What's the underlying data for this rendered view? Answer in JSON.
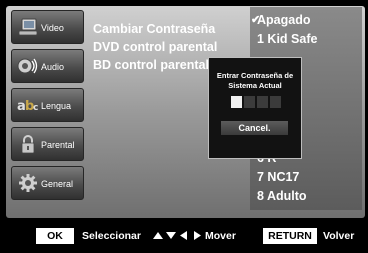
{
  "sidebar": {
    "items": [
      {
        "label": "Video",
        "icon": "video-icon"
      },
      {
        "label": "Audio",
        "icon": "speaker-icon"
      },
      {
        "label": "Lengua",
        "icon": "language-icon"
      },
      {
        "label": "Parental",
        "icon": "lock-icon"
      },
      {
        "label": "General",
        "icon": "gear-icon"
      }
    ]
  },
  "menu": {
    "items": [
      {
        "label": "Cambiar Contraseña"
      },
      {
        "label": "DVD control parental"
      },
      {
        "label": "BD control parental"
      }
    ]
  },
  "options": {
    "items": [
      {
        "label": "Apagado",
        "selected": true
      },
      {
        "label": "1 Kid Safe"
      },
      {
        "label": "6 R"
      },
      {
        "label": "7 NC17"
      },
      {
        "label": "8 Adulto"
      }
    ]
  },
  "dialog": {
    "title": "Entrar Contraseña de Sistema Actual",
    "pin_length": 4,
    "pin_active_index": 0,
    "cancel_label": "Cancel."
  },
  "footer": {
    "ok_key": "OK",
    "ok_label": "Seleccionar",
    "move_label": "Mover",
    "return_key": "RETURN",
    "return_label": "Volver"
  }
}
